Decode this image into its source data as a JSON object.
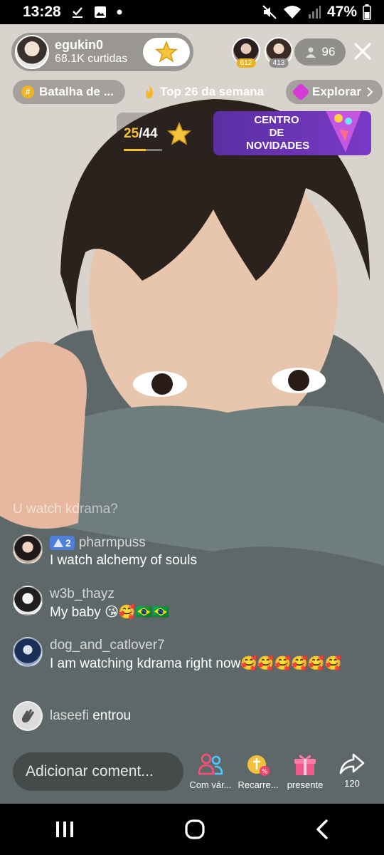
{
  "status_bar": {
    "time": "13:28",
    "battery": "47%"
  },
  "host": {
    "username": "egukin0",
    "likes": "68.1K curtidas"
  },
  "top_viewers": [
    {
      "badge": "612"
    },
    {
      "badge": "413"
    }
  ],
  "viewer_count": "96",
  "pills": {
    "battle": "Batalha de ...",
    "top": "Top 26 da semana",
    "explore": "Explorar"
  },
  "goal": {
    "current": "25",
    "total": "/44",
    "progress": 0.568
  },
  "banner": {
    "label": "CENTRO DE NOVIDADES"
  },
  "chat": {
    "faded_text": "U watch kdrama?",
    "messages": [
      {
        "user": "pharmpuss",
        "level": "2",
        "text": "I watch alchemy of souls",
        "emoji": ""
      },
      {
        "user": "w3b_thayz",
        "level": "",
        "text": "My baby ",
        "emoji": "😘🥰🇧🇷🇧🇷"
      },
      {
        "user": "dog_and_catlover7",
        "level": "",
        "text": "I am watching kdrama right now",
        "emoji": "🥰🥰🥰🥰🥰🥰"
      }
    ],
    "join": {
      "user": "laseefi",
      "text": "entrou"
    }
  },
  "comment_input": {
    "placeholder": "Adicionar coment..."
  },
  "actions": [
    {
      "label": "Com vár...",
      "icon": "multi-guest-icon"
    },
    {
      "label": "Recarre...",
      "icon": "recharge-coin-icon"
    },
    {
      "label": "presente",
      "icon": "gift-icon"
    },
    {
      "label": "120",
      "icon": "share-icon"
    }
  ],
  "colors": {
    "accent_gold": "#f3c130",
    "banner_purple": "#6a35b8",
    "level_blue": "#4f7fd9",
    "gift_pink": "#f25a8c"
  }
}
